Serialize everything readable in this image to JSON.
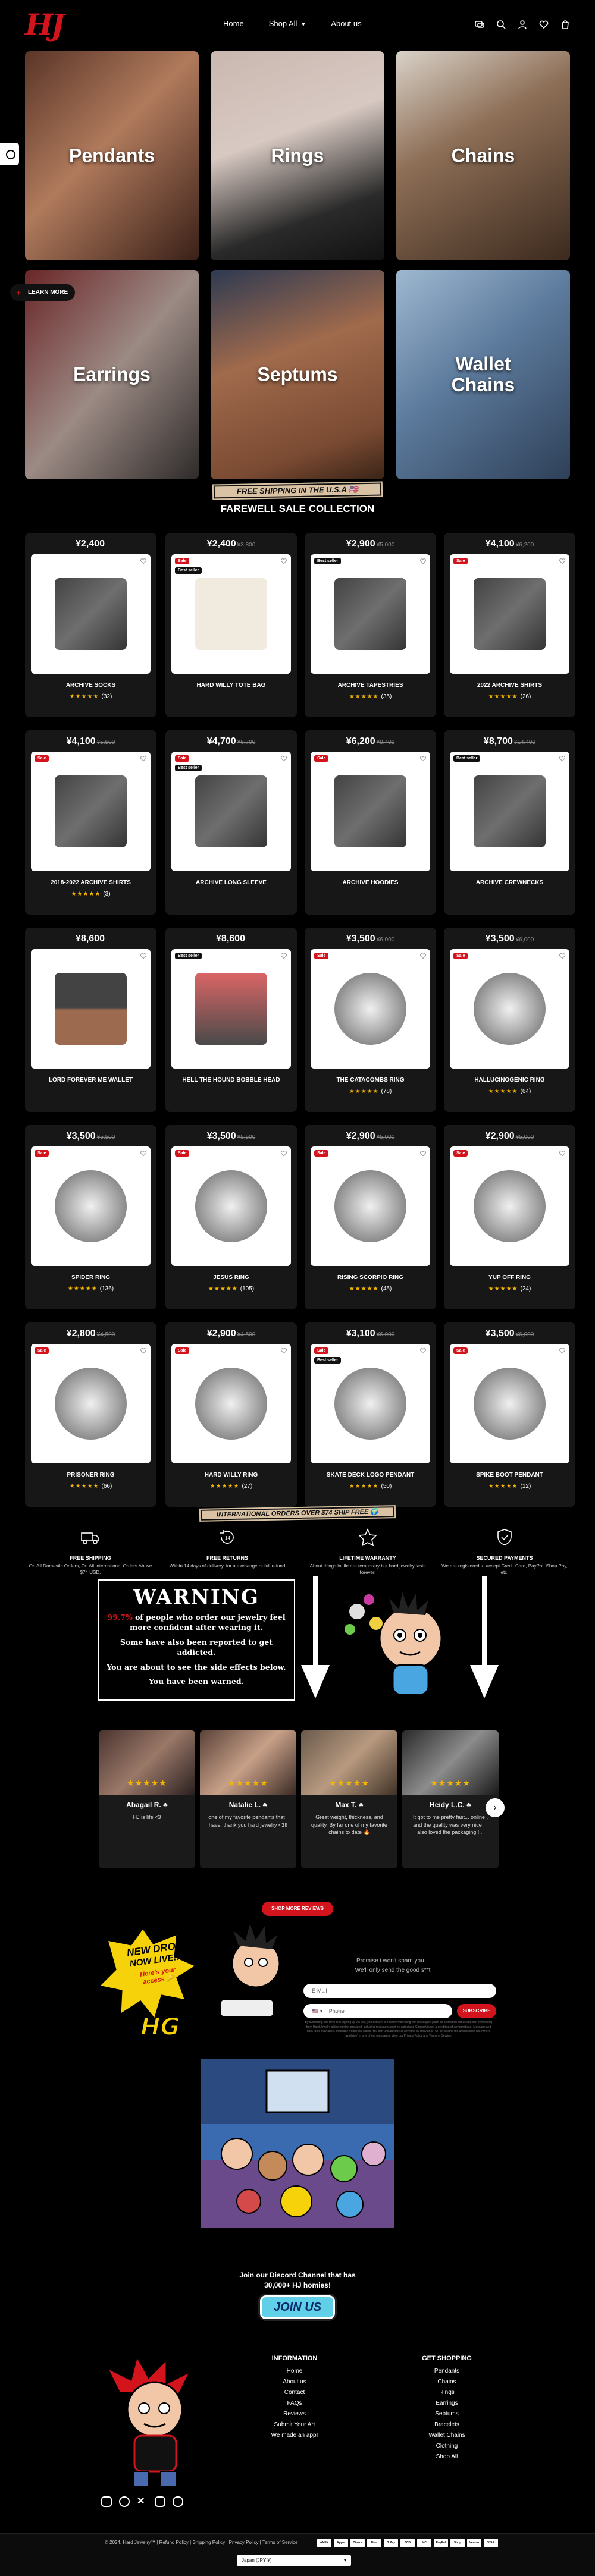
{
  "nav": {
    "home": "Home",
    "shop_all": "Shop All",
    "about": "About us"
  },
  "categories": [
    {
      "label": "Pendants"
    },
    {
      "label": "Rings"
    },
    {
      "label": "Chains"
    },
    {
      "label": "Earrings"
    },
    {
      "label": "Septums"
    },
    {
      "label": "Wallet\nChains"
    }
  ],
  "learn_more": "LEARN MORE",
  "banner_shipping": "FREE SHIPPING IN THE U.S.A",
  "collection_title": "FAREWELL SALE COLLECTION",
  "products": [
    {
      "price": "¥2,400",
      "old": "",
      "name": "ARCHIVE SOCKS",
      "stars": "★★★★★",
      "count": "(32)",
      "badges": []
    },
    {
      "price": "¥2,400",
      "old": "¥3,800",
      "name": "HARD WILLY TOTE BAG",
      "stars": "",
      "count": "",
      "badges": [
        "Sale",
        "Best seller"
      ]
    },
    {
      "price": "¥2,900",
      "old": "¥5,000",
      "name": "ARCHIVE TAPESTRIES",
      "stars": "★★★★★",
      "count": "(35)",
      "badges": [
        "Best seller"
      ]
    },
    {
      "price": "¥4,100",
      "old": "¥6,200",
      "name": "2022 ARCHIVE SHIRTS",
      "stars": "★★★★★",
      "count": "(26)",
      "badges": [
        "Sale"
      ]
    },
    {
      "price": "¥4,100",
      "old": "¥5,500",
      "name": "2018-2022 ARCHIVE SHIRTS",
      "stars": "★★★★★",
      "count": "(3)",
      "badges": [
        "Sale"
      ]
    },
    {
      "price": "¥4,700",
      "old": "¥6,700",
      "name": "ARCHIVE LONG SLEEVE",
      "stars": "",
      "count": "",
      "badges": [
        "Sale",
        "Best seller"
      ]
    },
    {
      "price": "¥6,200",
      "old": "¥9,400",
      "name": "ARCHIVE HOODIES",
      "stars": "",
      "count": "",
      "badges": [
        "Sale"
      ]
    },
    {
      "price": "¥8,700",
      "old": "¥14,400",
      "name": "ARCHIVE CREWNECKS",
      "stars": "",
      "count": "",
      "badges": [
        "Best seller"
      ]
    },
    {
      "price": "¥8,600",
      "old": "",
      "name": "LORD FOREVER ME WALLET",
      "stars": "",
      "count": "",
      "badges": []
    },
    {
      "price": "¥8,600",
      "old": "",
      "name": "HELL THE HOUND BOBBLE HEAD",
      "stars": "",
      "count": "",
      "badges": [
        "Best seller"
      ]
    },
    {
      "price": "¥3,500",
      "old": "¥6,000",
      "name": "THE CATACOMBS RING",
      "stars": "★★★★★",
      "count": "(78)",
      "badges": [
        "Sale"
      ]
    },
    {
      "price": "¥3,500",
      "old": "¥6,000",
      "name": "HALLUCINOGENIC RING",
      "stars": "★★★★★",
      "count": "(64)",
      "badges": [
        "Sale"
      ]
    },
    {
      "price": "¥3,500",
      "old": "¥5,500",
      "name": "SPIDER RING",
      "stars": "★★★★★",
      "count": "(136)",
      "badges": [
        "Sale"
      ]
    },
    {
      "price": "¥3,500",
      "old": "¥5,500",
      "name": "JESUS RING",
      "stars": "★★★★★",
      "count": "(105)",
      "badges": [
        "Sale"
      ]
    },
    {
      "price": "¥2,900",
      "old": "¥5,000",
      "name": "RISING SCORPIO RING",
      "stars": "★★★★★",
      "count": "(45)",
      "badges": [
        "Sale"
      ]
    },
    {
      "price": "¥2,900",
      "old": "¥5,000",
      "name": "YUP OFF RING",
      "stars": "★★★★★",
      "count": "(24)",
      "badges": [
        "Sale"
      ]
    },
    {
      "price": "¥2,800",
      "old": "¥4,500",
      "name": "PRISONER RING",
      "stars": "★★★★★",
      "count": "(66)",
      "badges": [
        "Sale"
      ]
    },
    {
      "price": "¥2,900",
      "old": "¥4,500",
      "name": "HARD WILLY RING",
      "stars": "★★★★★",
      "count": "(27)",
      "badges": [
        "Sale"
      ]
    },
    {
      "price": "¥3,100",
      "old": "¥6,000",
      "name": "SKATE DECK LOGO PENDANT",
      "stars": "★★★★★",
      "count": "(50)",
      "badges": [
        "Sale",
        "Best seller"
      ]
    },
    {
      "price": "¥3,500",
      "old": "¥6,000",
      "name": "SPIKE BOOT PENDANT",
      "stars": "★★★★★",
      "count": "(12)",
      "badges": [
        "Sale"
      ]
    }
  ],
  "banner_international": "INTERNATIONAL ORDERS OVER $74 SHIP FREE",
  "features": [
    {
      "title": "FREE SHIPPING",
      "desc": "On All Domestic Orders, On All International Orders Above $74 USD."
    },
    {
      "title": "FREE RETURNS",
      "desc": "Within 14 days of delivery, for a exchange or full refund"
    },
    {
      "title": "LIFETIME WARRANTY",
      "desc": "About things in life are temporary but hard jewelry lasts forever."
    },
    {
      "title": "SECURED PAYMENTS",
      "desc": "We are registered to accept Credit Card, PayPal, Shop Pay, etc."
    }
  ],
  "warning": {
    "title": "WARNING",
    "pct": "99.7%",
    "line1": " of people who order our jewelry feel more confident after wearing it.",
    "line2": "Some have also been reported to get addicted.",
    "line3": "You are about to see the side effects below.",
    "line4": "You have been warned."
  },
  "reviews": [
    {
      "name": "Abagail R. ♣",
      "stars": "★★★★★",
      "text": "HJ is life <3"
    },
    {
      "name": "Natalie L. ♣",
      "stars": "★★★★★",
      "text": "one of my favorite pendants that I have, thank you hard jewelry <3!!"
    },
    {
      "name": "Max T. ♣",
      "stars": "★★★★★",
      "text": "Great weight, thickness, and quality. By far one of my favorite chains to date 🔥"
    },
    {
      "name": "Heidy L.C. ♣",
      "stars": "★★★★★",
      "text": "It got to me pretty fast... online , and the quality was very nice , I also loved the packaging !..."
    }
  ],
  "shop_reviews": "SHOP MORE REVIEWS",
  "newsletter": {
    "line1": "Promise i won't spam you...",
    "line2": "We'll only send the good s**t",
    "email_placeholder": "E-Mail",
    "phone_placeholder": "Phone",
    "subscribe": "SUBSCRIBE",
    "fine": "By submitting this form and signing up via text, you consent to receive marketing text messages (such as promotion codes and cart reminders) from Hard Jewelry at the number provided, including messages sent by autodialer. Consent is not a condition of any purchase. Message and data rates may apply. Message frequency varies. You can unsubscribe at any time by replying STOP or clicking the unsubscribe link (where available) in one of our messages. View our Privacy Policy and Terms of Service."
  },
  "drop": {
    "line1": "NEW DROP",
    "line2": "NOW LIVE!!!",
    "line3": "Here's your",
    "line4": "access 🔑"
  },
  "discord": {
    "text": "Join our Discord Channel that has 30,000+ HJ homies!",
    "button": "JOIN US"
  },
  "footer": {
    "info_title": "INFORMATION",
    "info": [
      "Home",
      "About us",
      "Contact",
      "FAQs",
      "Reviews",
      "Submit Your Art",
      "We made an app!"
    ],
    "shop_title": "GET SHOPPING",
    "shop": [
      "Pendants",
      "Chains",
      "Rings",
      "Earrings",
      "Septums",
      "Bracelets",
      "Wallet Chains",
      "Clothing",
      "Shop All"
    ],
    "copyright": "© 2024, Hard Jewelry™ | Refund Policy | Shipping Policy | Privacy Policy | Terms of Service",
    "payments": [
      "AMEX",
      "Apple",
      "Diners",
      "Disc",
      "G Pay",
      "JCB",
      "MC",
      "PayPal",
      "Shop",
      "Venmo",
      "VISA"
    ],
    "currency": "Japan (JPY ¥)"
  },
  "colors": {
    "accent": "#d4141c",
    "star": "#f4b400",
    "banner": "#d9c3a4"
  }
}
